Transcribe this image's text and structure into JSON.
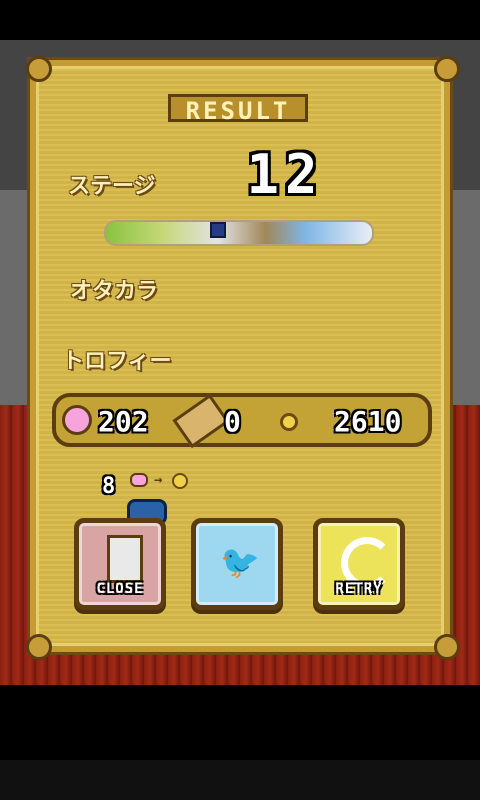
{
  "screen": {
    "title": "RESULT",
    "stage_label": "ステージ",
    "stage_value": "12",
    "treasure_label": "オタカラ",
    "trophy_label": "トロフィー"
  },
  "totals": {
    "pink_count": "202",
    "ticket_count": "0",
    "coin_count": "2610"
  },
  "bonus": {
    "small_count": "8"
  },
  "buttons": {
    "close_label": "CLOSE",
    "retry_label": "RETRY"
  }
}
